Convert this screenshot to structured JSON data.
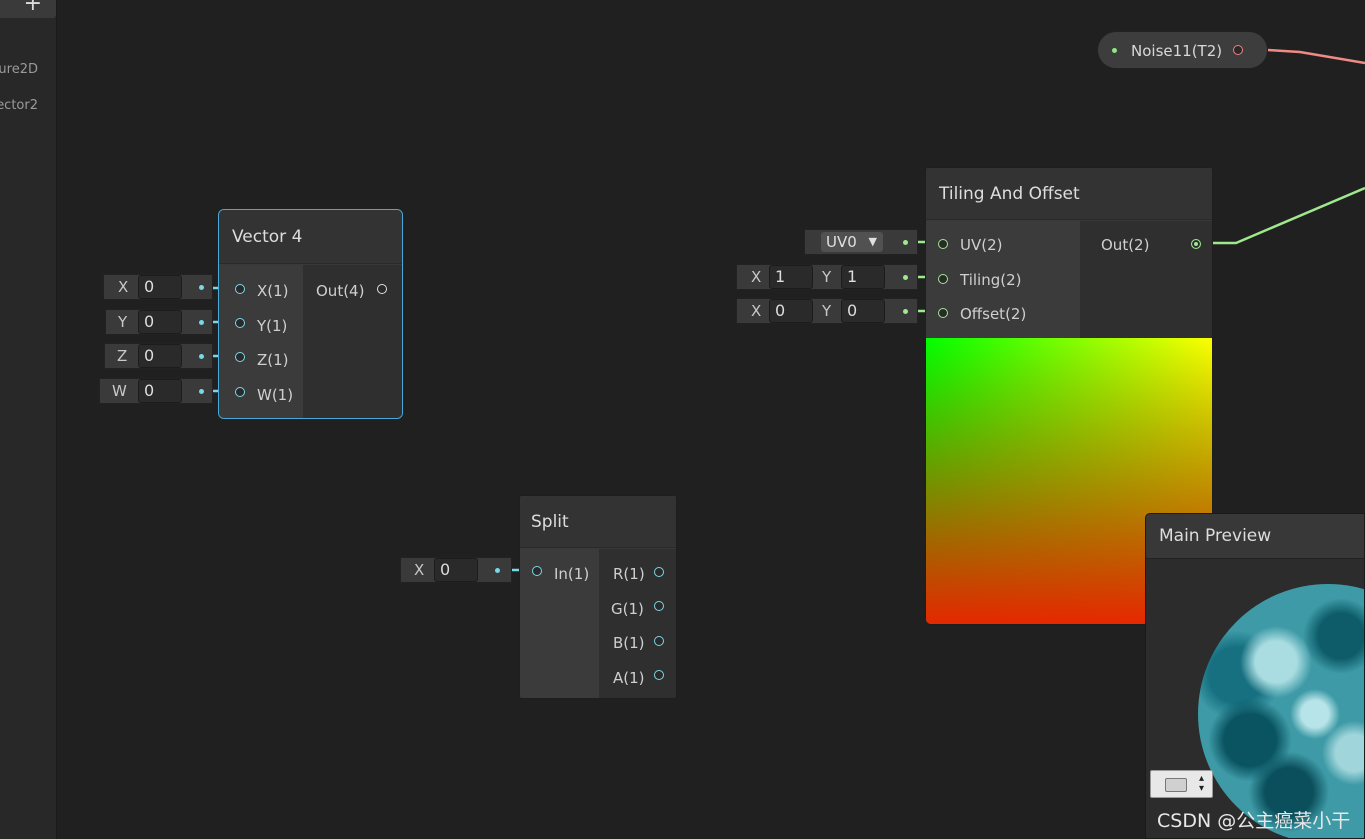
{
  "sidebar": {
    "add_label": "+",
    "properties": [
      "ure2D",
      "ector2"
    ]
  },
  "noise_node": {
    "label": "Noise11(T2)"
  },
  "vector4": {
    "title": "Vector 4",
    "inputs": [
      {
        "name": "X",
        "value": "0",
        "port": "X(1)"
      },
      {
        "name": "Y",
        "value": "0",
        "port": "Y(1)"
      },
      {
        "name": "Z",
        "value": "0",
        "port": "Z(1)"
      },
      {
        "name": "W",
        "value": "0",
        "port": "W(1)"
      }
    ],
    "output": "Out(4)"
  },
  "tiling": {
    "title": "Tiling And Offset",
    "uv_dropdown": "UV0",
    "uv_port": "UV(2)",
    "tiling_port": "Tiling(2)",
    "offset_port": "Offset(2)",
    "output": "Out(2)",
    "tiling_x_label": "X",
    "tiling_x": "1",
    "tiling_y_label": "Y",
    "tiling_y": "1",
    "offset_x_label": "X",
    "offset_x": "0",
    "offset_y_label": "Y",
    "offset_y": "0"
  },
  "split": {
    "title": "Split",
    "input_label": "X",
    "input_value": "0",
    "input_port": "In(1)",
    "outputs": [
      "R(1)",
      "G(1)",
      "B(1)",
      "A(1)"
    ]
  },
  "main_preview": {
    "title": "Main Preview"
  },
  "watermark": "CSDN @公主癌菜小干",
  "colors": {
    "cyan_port": "#7ad7e8",
    "green_port": "#9ee88e",
    "red_port": "#f08080",
    "selection": "#4aa9d9"
  }
}
